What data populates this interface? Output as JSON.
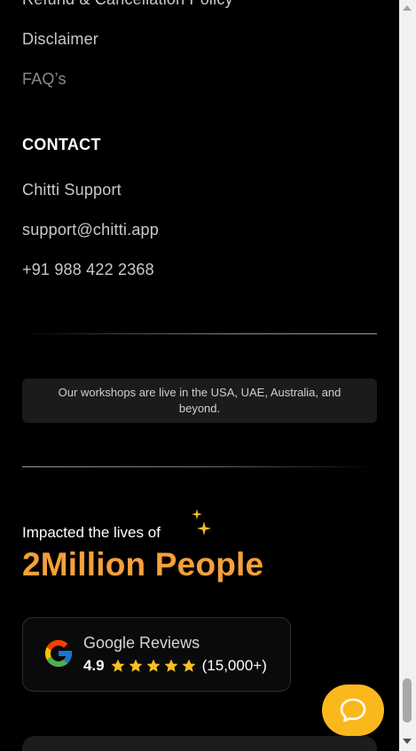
{
  "links": {
    "refund": "Refund & Cancellation Policy",
    "disclaimer": "Disclaimer",
    "faq": "FAQ’s"
  },
  "contact": {
    "heading": "CONTACT",
    "support_name": "Chitti Support",
    "email": "support@chitti.app",
    "phone": "+91 988 422 2368"
  },
  "notice": "Our workshops are live in the USA, UAE, Australia, and beyond.",
  "impact": {
    "label": "Impacted the lives of",
    "number": "2Million People"
  },
  "reviews": {
    "title": "Google Reviews",
    "rating": "4.9",
    "stars": 5,
    "count": "(15,000+)"
  },
  "colors": {
    "accent_orange": "#f6a03a",
    "star_yellow": "#fbbf24",
    "chat_button": "#fbb81c"
  },
  "icons": {
    "sparkle": "sparkle-icon",
    "google": "google-icon",
    "star": "star-icon",
    "chat": "chat-icon"
  }
}
